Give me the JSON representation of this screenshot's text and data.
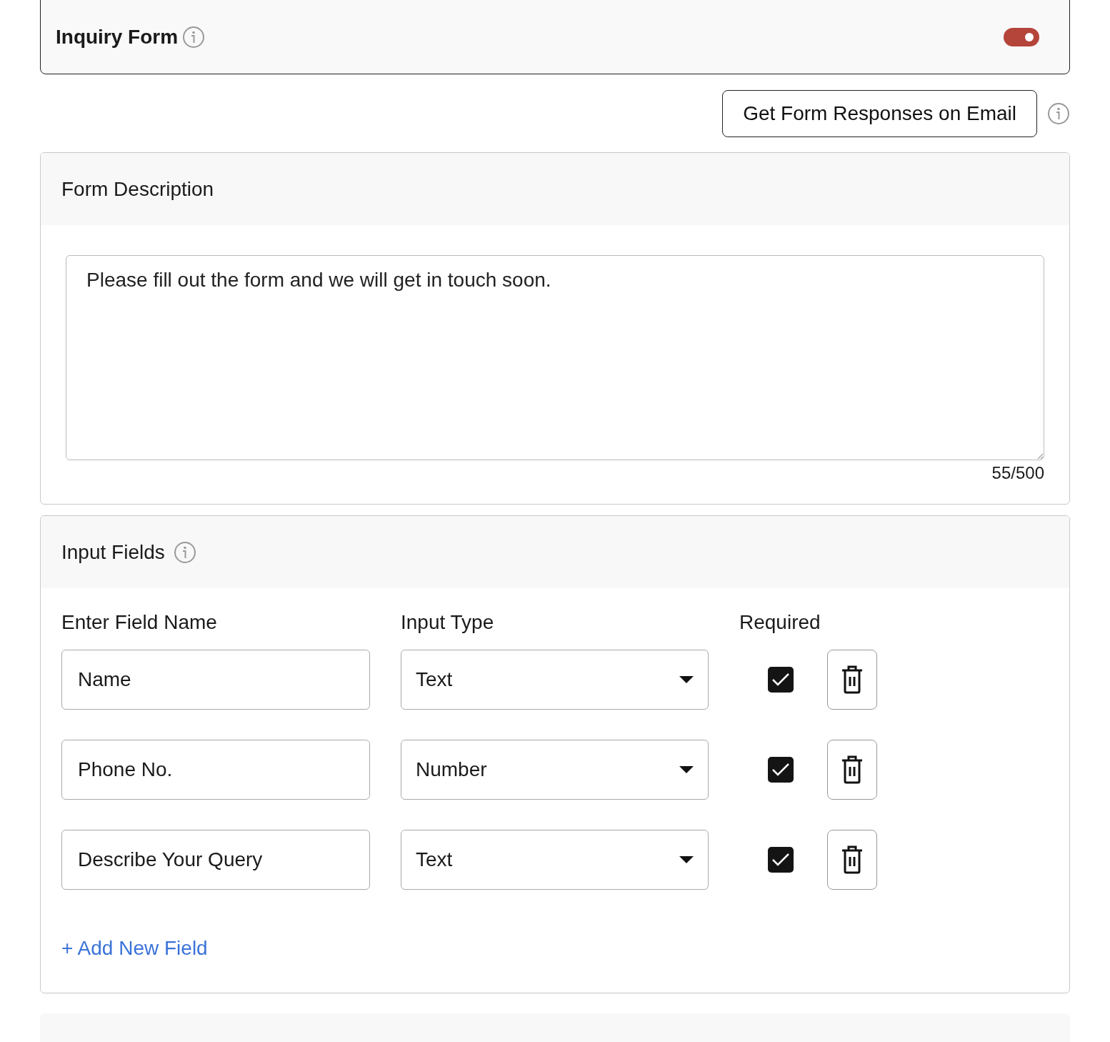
{
  "header": {
    "title": "Inquiry Form",
    "enabled": true
  },
  "email_button": {
    "label": "Get Form Responses on Email"
  },
  "description": {
    "title": "Form Description",
    "value": "Please fill out the form and we will get in touch soon.",
    "counter": "55/500"
  },
  "input_fields": {
    "title": "Input Fields",
    "columns": [
      "Enter Field Name",
      "Input Type",
      "Required"
    ],
    "rows": [
      {
        "name": "Name",
        "type": "Text",
        "required": true
      },
      {
        "name": "Phone No.",
        "type": "Number",
        "required": true
      },
      {
        "name": "Describe Your Query",
        "type": "Text",
        "required": true
      }
    ],
    "add_link": "+ Add New Field"
  }
}
